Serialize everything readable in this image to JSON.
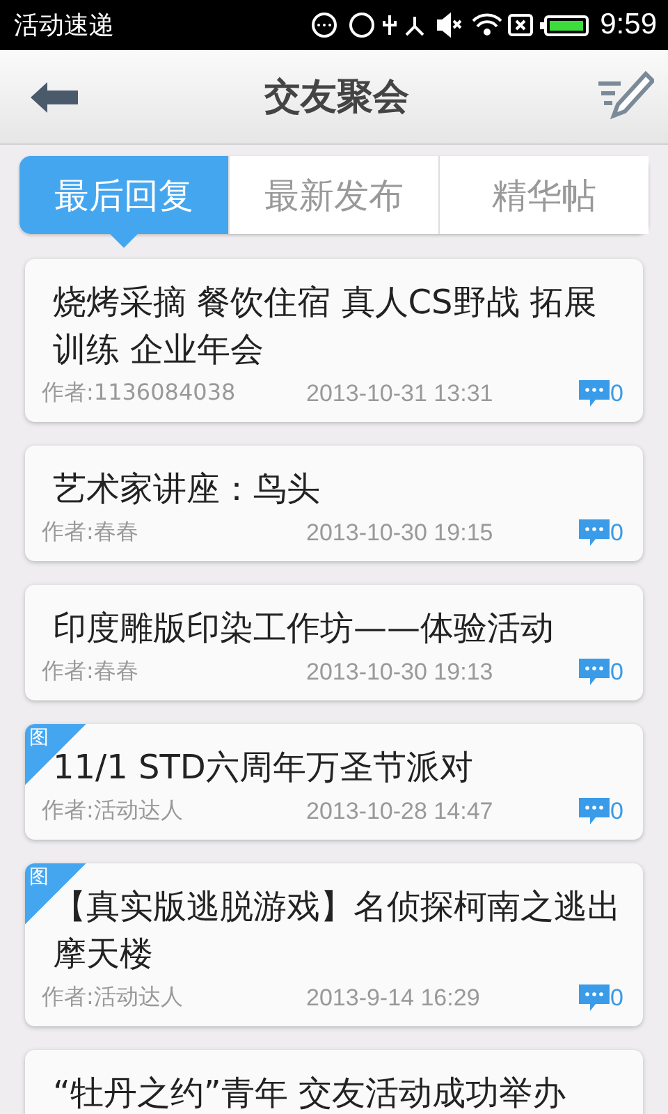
{
  "status_bar": {
    "app_name": "活动速递",
    "time": "9:59"
  },
  "header": {
    "title": "交友聚会"
  },
  "tabs": [
    {
      "label": "最后回复",
      "selected": true
    },
    {
      "label": "最新发布",
      "selected": false
    },
    {
      "label": "精华帖",
      "selected": false
    }
  ],
  "posts": [
    {
      "title": "烧烤采摘  餐饮住宿 真人CS野战 拓展训练 企业年会",
      "author": "作者:1136084038",
      "time": "2013-10-31 13:31",
      "replies": "0"
    },
    {
      "title": "艺术家讲座：鸟头",
      "author": "作者:春春",
      "time": "2013-10-30 19:15",
      "replies": "0"
    },
    {
      "title": "印度雕版印染工作坊——体验活动",
      "author": "作者:春春",
      "time": "2013-10-30 19:13",
      "replies": "0"
    },
    {
      "tag": "图",
      "title": "11/1 STD六周年万圣节派对",
      "author": "作者:活动达人",
      "time": "2013-10-28 14:47",
      "replies": "0"
    },
    {
      "tag": "图",
      "title": "【真实版逃脱游戏】名侦探柯南之逃出摩天楼",
      "author": "作者:活动达人",
      "time": "2013-9-14 16:29",
      "replies": "0"
    },
    {
      "title": "“牡丹之约”青年 交友活动成功举办"
    }
  ]
}
